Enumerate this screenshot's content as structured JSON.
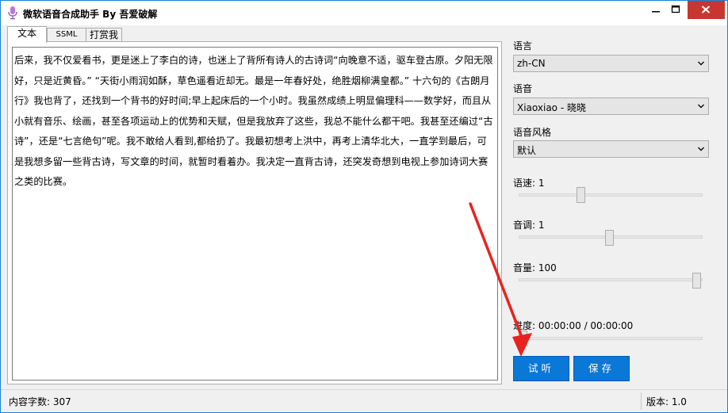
{
  "titlebar": {
    "title": "微软语音合成助手 By 吾爱破解",
    "app_icon": "microphone-icon",
    "minimize_icon": "minimize-icon",
    "maximize_icon": "maximize-icon",
    "close_icon": "close-icon"
  },
  "tabs": [
    {
      "label": "文本",
      "active": true
    },
    {
      "label": "SSML",
      "active": false
    },
    {
      "label": "打赏我",
      "active": false
    }
  ],
  "editor": {
    "text": "后来，我不仅爱看书，更是迷上了李白的诗，也迷上了背所有诗人的古诗词“向晚意不适，驱车登古原。夕阳无限好，只是近黄昏。” “天街小雨润如酥，草色遥看近却无。最是一年春好处，绝胜烟柳满皇都。” 十六句的《古朗月行》我也背了，还找到一个背书的好时间;早上起床后的一个小时。我虽然成绩上明显偏理科——数学好，而且从小就有音乐、绘画，甚至各项运动上的优势和天赋，但是我放弃了这些，我总不能什么都干吧。我甚至还编过“古诗”，还是“七言绝句”呢。我不敢给人看到,都给扔了。我最初想考上洪中，再考上清华北大，一直学到最后，可是我想多留一些背古诗，写文章的时间，就暂时看着办。我决定一直背古诗，还突发奇想到电视上参加诗词大赛之类的比赛。"
  },
  "settings": {
    "language_label": "语言",
    "language_value": "zh-CN",
    "voice_label": "语音",
    "voice_value": "Xiaoxiao - 晓晓",
    "style_label": "语音风格",
    "style_value": "默认",
    "rate_label": "语速: 1",
    "rate_fraction": 0.34,
    "pitch_label": "音调: 1",
    "pitch_fraction": 0.5,
    "volume_label": "音量: 100",
    "volume_fraction": 1.0,
    "progress_label": "进度: 00:00:00 / 00:00:00",
    "progress_fraction": 0.0,
    "dropdown_icon": "chevron-down-icon"
  },
  "buttons": {
    "listen": "试听",
    "save": "保存"
  },
  "status": {
    "char_count": "内容字数: 307",
    "version": "版本: 1.0"
  },
  "annotation": {
    "color": "#e8231f",
    "icon": "red-arrow-icon"
  }
}
